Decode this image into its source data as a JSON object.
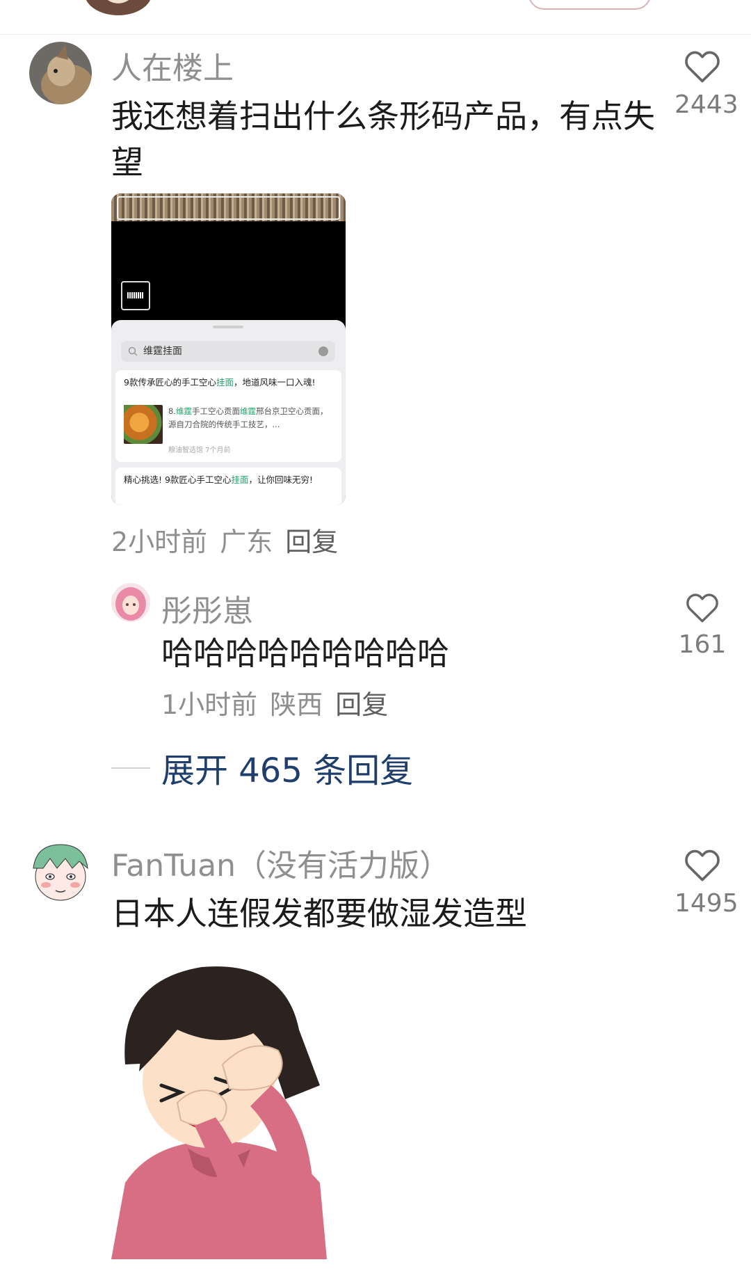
{
  "comments": [
    {
      "user": "人在楼上",
      "text": "我还想着扫出什么条形码产品，有点失望",
      "time": "2小时前",
      "location": "广东",
      "reply_label": "回复",
      "likes": "2443",
      "attachment": {
        "search_query": "维霆挂面",
        "result1_pre": "9款传承匠心的手工空心",
        "result1_hl": "挂面",
        "result1_post": "，地道风味一口入魂!",
        "result1_sub_pre": "8.",
        "result1_sub_hl": "维霆",
        "result1_sub_mid": "手工空心贡面",
        "result1_sub_hl2": "维霆",
        "result1_sub_post": "邢台京卫空心贡面，源自刀合院的传统手工技艺，...",
        "result1_meta": "粮油智选馆 7个月前",
        "result2_pre": "精心挑选! 9款匠心手工空心",
        "result2_hl": "挂面",
        "result2_post": "，让你回味无穷!"
      }
    },
    {
      "user": "彤彤崽",
      "text": "哈哈哈哈哈哈哈哈哈",
      "time": "1小时前",
      "location": "陕西",
      "reply_label": "回复",
      "likes": "161"
    },
    {
      "user": "FanTuan（没有活力版）",
      "text": "日本人连假发都要做湿发造型",
      "likes": "1495"
    }
  ],
  "expand_replies": "展开 465 条回复",
  "colors": {
    "expand_link": "#1f3e6b",
    "username": "#8f8f8f",
    "highlight": "#1aa46a"
  },
  "icons": [
    "heart-outline-icon",
    "search-icon",
    "clear-icon"
  ]
}
